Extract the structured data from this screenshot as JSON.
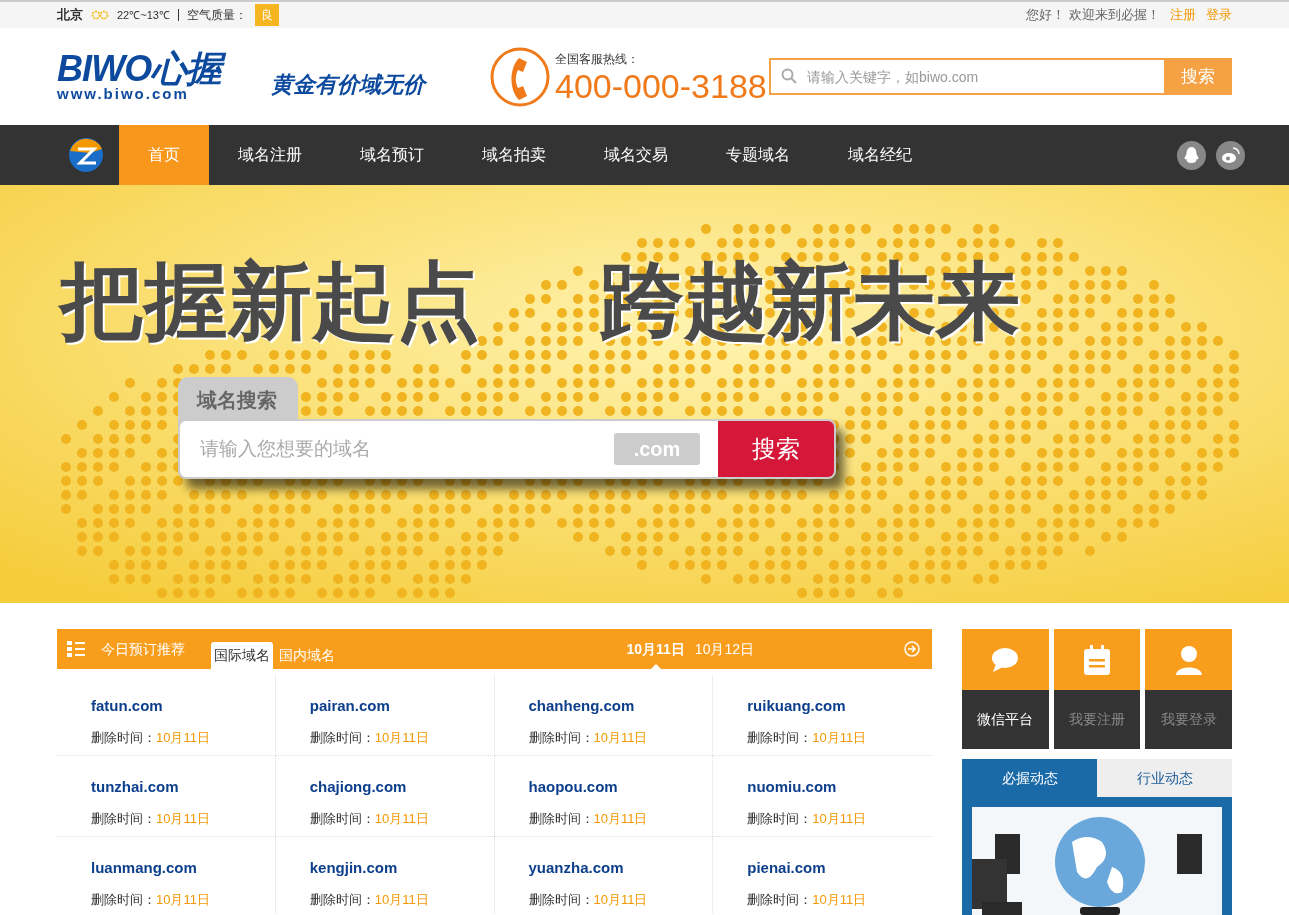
{
  "topbar": {
    "city": "北京",
    "temperature": "22℃~13℃",
    "air_label": "空气质量：",
    "air_value": "良",
    "greeting": "您好！ 欢迎来到必握！",
    "links": [
      "注册",
      "登录"
    ]
  },
  "header": {
    "logo": "BIWO心握",
    "logo_url": "www.biwo.com",
    "slogan": "黄金有价域无价",
    "hotline_label": "全国客服热线：",
    "hotline": "400-000-3188",
    "search": {
      "placeholder": "请输入关键字，如biwo.com",
      "button": "搜索"
    }
  },
  "nav": {
    "items": [
      {
        "label": "首页",
        "selected": true
      },
      {
        "label": "域名注册",
        "selected": false
      },
      {
        "label": "域名预订",
        "selected": false
      },
      {
        "label": "域名拍卖",
        "selected": false
      },
      {
        "label": "域名交易",
        "selected": false
      },
      {
        "label": "专题域名",
        "selected": false
      },
      {
        "label": "域名经纪",
        "selected": false
      }
    ]
  },
  "banner": {
    "slogan_left": "把握新起点",
    "slogan_right": "跨越新未来",
    "search_tab": "域名搜索",
    "placeholder": "请输入您想要的域名",
    "suffix": ".com",
    "button": "搜索"
  },
  "recommend": {
    "title": "今日预订推荐",
    "tabs": [
      {
        "label": "国际域名",
        "selected": true
      },
      {
        "label": "国内域名",
        "selected": false
      }
    ],
    "dates": [
      {
        "label": "10月11日",
        "selected": true
      },
      {
        "label": "10月12日",
        "selected": false
      }
    ],
    "items": [
      {
        "domain": "fatun.com",
        "label": "删除时间：",
        "date": "10月11日"
      },
      {
        "domain": "pairan.com",
        "label": "删除时间：",
        "date": "10月11日"
      },
      {
        "domain": "chanheng.com",
        "label": "删除时间：",
        "date": "10月11日"
      },
      {
        "domain": "ruikuang.com",
        "label": "删除时间：",
        "date": "10月11日"
      },
      {
        "domain": "tunzhai.com",
        "label": "删除时间：",
        "date": "10月11日"
      },
      {
        "domain": "chajiong.com",
        "label": "删除时间：",
        "date": "10月11日"
      },
      {
        "domain": "haopou.com",
        "label": "删除时间：",
        "date": "10月11日"
      },
      {
        "domain": "nuomiu.com",
        "label": "删除时间：",
        "date": "10月11日"
      },
      {
        "domain": "luanmang.com",
        "label": "删除时间：",
        "date": "10月11日"
      },
      {
        "domain": "kengjin.com",
        "label": "删除时间：",
        "date": "10月11日"
      },
      {
        "domain": "yuanzha.com",
        "label": "删除时间：",
        "date": "10月11日"
      },
      {
        "domain": "pienai.com",
        "label": "删除时间：",
        "date": "10月11日"
      }
    ]
  },
  "quick_links": [
    {
      "kind": "chat",
      "label": "微信平台",
      "selected": true
    },
    {
      "kind": "notepad",
      "label": "我要注册",
      "selected": false
    },
    {
      "kind": "user",
      "label": "我要登录",
      "selected": false
    }
  ],
  "news": {
    "tabs": [
      {
        "label": "必握动态",
        "selected": true
      },
      {
        "label": "行业动态",
        "selected": false
      }
    ]
  }
}
